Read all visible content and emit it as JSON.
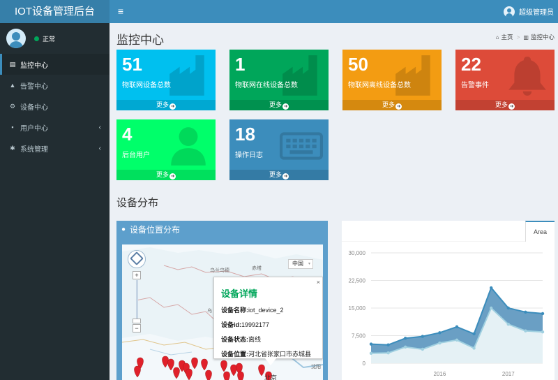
{
  "app": {
    "title": "IOT设备管理后台",
    "menu_toggle": "≡"
  },
  "user": {
    "name": "超级管理员",
    "status": "正常"
  },
  "sidebar": {
    "items": [
      {
        "icon": "▤",
        "label": "监控中心",
        "active": true,
        "chevron": ""
      },
      {
        "icon": "▲",
        "label": "告警中心",
        "active": false,
        "chevron": ""
      },
      {
        "icon": "⚙",
        "label": "设备中心",
        "active": false,
        "chevron": ""
      },
      {
        "icon": "▪",
        "label": "用户中心",
        "active": false,
        "chevron": "‹"
      },
      {
        "icon": "✱",
        "label": "系统管理",
        "active": false,
        "chevron": "‹"
      }
    ]
  },
  "header": {
    "title": "监控中心",
    "breadcrumb": {
      "home": "主页",
      "current": "监控中心"
    }
  },
  "tiles": [
    {
      "value": "51",
      "label": "物联网设备总数",
      "more": "更多",
      "color": "#00c0ef",
      "icon": "factory-icon"
    },
    {
      "value": "1",
      "label": "物联网在线设备总数",
      "more": "更多",
      "color": "#00a65a",
      "icon": "factory-icon"
    },
    {
      "value": "50",
      "label": "物联网离线设备总数",
      "more": "更多",
      "color": "#f39c12",
      "icon": "factory-icon"
    },
    {
      "value": "22",
      "label": "告警事件",
      "more": "更多",
      "color": "#dd4b39",
      "icon": "bell-icon"
    },
    {
      "value": "4",
      "label": "后台用户",
      "more": "更多",
      "color": "#00ff6a",
      "icon": "user-icon"
    },
    {
      "value": "18",
      "label": "操作日志",
      "more": "更多",
      "color": "#3c8dbc",
      "icon": "keyboard-icon"
    }
  ],
  "section": {
    "title": "设备分布"
  },
  "map": {
    "title": "设备位置分布",
    "country_select": "中国",
    "places": [
      "乌兰乌德",
      "赤塔",
      "乌",
      "北京",
      "沈阳"
    ],
    "popup": {
      "title": "设备详情",
      "rows": [
        {
          "label": "设备名称:",
          "value": "iot_device_2"
        },
        {
          "label": "设备id:",
          "value": "19992177"
        },
        {
          "label": "设备状态:",
          "value": "离线"
        },
        {
          "label": "设备位置:",
          "value": "河北省张家口市赤城县"
        }
      ]
    }
  },
  "chart_tab": "Area",
  "chart_data": {
    "type": "area",
    "x": [
      "2015-03",
      "2015-06",
      "2015-09",
      "2015-12",
      "2016-03",
      "2016-06",
      "2016-09",
      "2016-12",
      "2017-03",
      "2017-06",
      "2017-09"
    ],
    "x_ticks": [
      "2016",
      "2017"
    ],
    "series": [
      {
        "values": [
          5200,
          5000,
          6800,
          7300,
          8300,
          9900,
          8000,
          20500,
          15000,
          13900,
          13500
        ],
        "color": "#3c8dbc"
      },
      {
        "values": [
          2700,
          2800,
          4400,
          3800,
          5500,
          6300,
          4100,
          15000,
          10600,
          8800,
          8500
        ],
        "color": "#a0d0e0"
      }
    ],
    "ylim": [
      0,
      30000
    ],
    "y_ticks": [
      "0",
      "7,500",
      "15,000",
      "22,500",
      "30,000"
    ],
    "grid": true
  }
}
